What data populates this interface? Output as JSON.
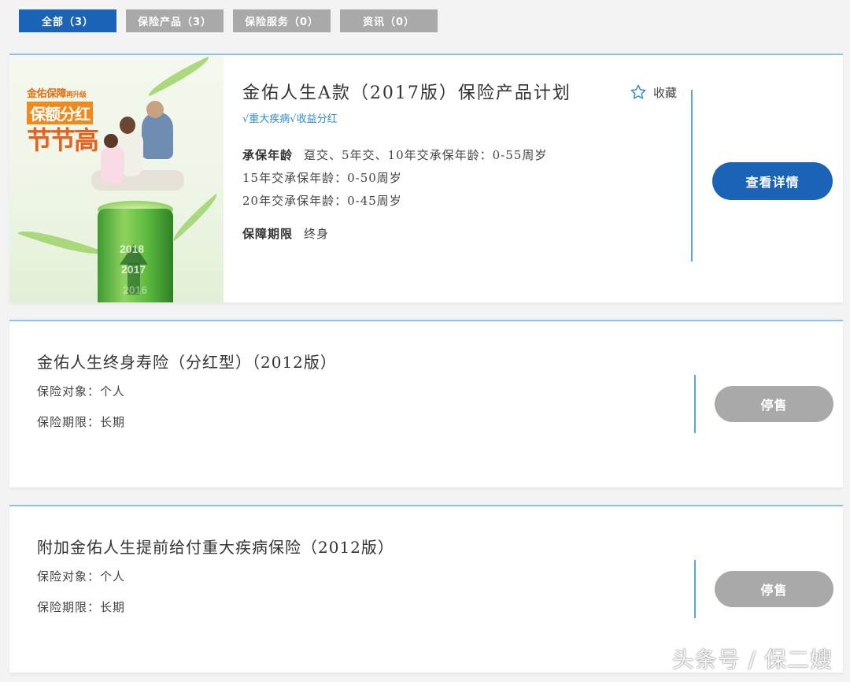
{
  "tabs": [
    {
      "label": "全部（3）",
      "active": true
    },
    {
      "label": "保险产品（3）",
      "active": false
    },
    {
      "label": "保险服务（0）",
      "active": false
    },
    {
      "label": "资讯（0）",
      "active": false
    }
  ],
  "card1": {
    "promo": {
      "line1": "金佑保障",
      "line1_small": "再升级",
      "line2": "保额分红",
      "line3": "节节高",
      "years": [
        "2018",
        "2017",
        "2016"
      ]
    },
    "title": "金佑人生A款（2017版）保险产品计划",
    "tags": "√重大疾病√收益分红",
    "age_label": "承保年龄",
    "age_line1": "趸交、5年交、10年交承保年龄：0-55周岁",
    "age_line2": "15年交承保年龄：0-50周岁",
    "age_line3": "20年交承保年龄：0-45周岁",
    "term_label": "保障期限",
    "term_value": "终身",
    "favorite_label": "收藏",
    "detail_button": "查看详情"
  },
  "card2": {
    "title": "金佑人生终身寿险（分红型）（2012版）",
    "target": "保险对象：个人",
    "term": "保险期限：长期",
    "status_button": "停售"
  },
  "card3": {
    "title": "附加金佑人生提前给付重大疾病保险（2012版）",
    "target": "保险对象：个人",
    "term": "保险期限：长期",
    "status_button": "停售"
  },
  "watermark": "头条号 / 保二嫂",
  "colors": {
    "primary": "#1b63b6",
    "inactive": "#a9a9a9",
    "tag_blue": "#2e8ad8",
    "divider": "#5aa6dd"
  }
}
